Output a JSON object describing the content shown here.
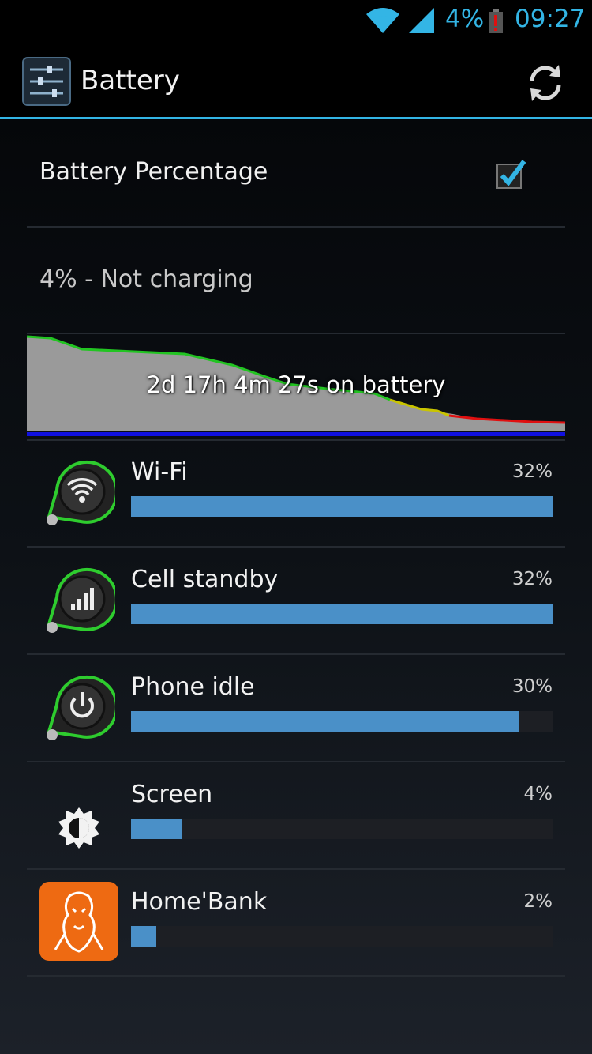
{
  "status_bar": {
    "battery_percent": "4%",
    "time": "09:27",
    "icons": [
      "wifi-icon",
      "signal-icon",
      "battery-low-icon"
    ]
  },
  "action_bar": {
    "title": "Battery",
    "icons": [
      "settings-app-icon",
      "refresh-icon"
    ]
  },
  "battery_percentage_pref": {
    "label": "Battery Percentage",
    "checked": true
  },
  "battery_status": "4% - Not charging",
  "graph": {
    "caption": "2d 17h 4m 27s on battery"
  },
  "usage": [
    {
      "name": "Wi-Fi",
      "percent_label": "32%",
      "fill": 1.0,
      "icon": "wifi-icon"
    },
    {
      "name": "Cell standby",
      "percent_label": "32%",
      "fill": 1.0,
      "icon": "cell-signal-icon"
    },
    {
      "name": "Phone idle",
      "percent_label": "30%",
      "fill": 0.92,
      "icon": "power-icon"
    },
    {
      "name": "Screen",
      "percent_label": "4%",
      "fill": 0.12,
      "icon": "brightness-icon"
    },
    {
      "name": "Home'Bank",
      "percent_label": "2%",
      "fill": 0.06,
      "icon": "homebank-app-icon"
    }
  ],
  "colors": {
    "accent": "#33b5e5",
    "bar": "#4a90c8",
    "graph_good": "#22c422",
    "graph_medium": "#c9c400",
    "graph_low": "#e01010"
  }
}
